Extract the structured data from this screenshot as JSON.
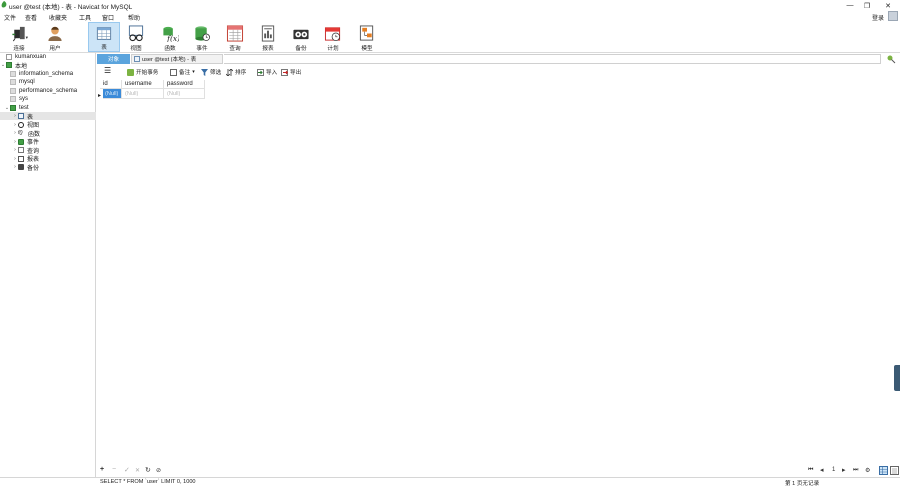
{
  "window": {
    "title": "user @test (本地) - 表 - Navicat for MySQL",
    "minimize": "—",
    "maximize": "❐",
    "close": "✕"
  },
  "menu": {
    "items": [
      "文件",
      "查看",
      "收藏夹",
      "工具",
      "窗口",
      "帮助"
    ],
    "login": "登录"
  },
  "ribbon": {
    "tools": [
      {
        "label": "连接",
        "icon": "connection-icon"
      },
      {
        "label": "用户",
        "icon": "user-icon"
      },
      {
        "label": "表",
        "icon": "table-icon"
      },
      {
        "label": "视图",
        "icon": "view-icon"
      },
      {
        "label": "函数",
        "icon": "function-icon"
      },
      {
        "label": "事件",
        "icon": "event-icon"
      },
      {
        "label": "查询",
        "icon": "query-icon"
      },
      {
        "label": "报表",
        "icon": "report-icon"
      },
      {
        "label": "备份",
        "icon": "backup-icon"
      },
      {
        "label": "计划",
        "icon": "schedule-icon"
      },
      {
        "label": "模型",
        "icon": "model-icon"
      }
    ],
    "active": "表"
  },
  "tree": {
    "root": "kumanxuan",
    "connection": "本地",
    "databases": [
      "information_schema",
      "mysql",
      "performance_schema",
      "sys"
    ],
    "open_db": "test",
    "children": [
      "表",
      "视图",
      "函数",
      "事件",
      "查询",
      "报表",
      "备份"
    ],
    "function_glyph": "f()"
  },
  "tabs": {
    "objects": "对象",
    "current": "user @test (本地) - 表"
  },
  "toolbar": {
    "menu_glyph": "☰",
    "begin_tx": "开始事务",
    "note": "备注",
    "note_caret": "▾",
    "filter": "筛选",
    "sort": "排序",
    "import": "导入",
    "export": "导出"
  },
  "grid": {
    "columns": [
      "id",
      "username",
      "password"
    ],
    "row_marker": "▸",
    "rows": [
      [
        "(Null)",
        "(Null)",
        "(Null)"
      ]
    ]
  },
  "bottom_nav": {
    "add": "+",
    "delete": "−",
    "apply": "✓",
    "cancel": "✕",
    "refresh": "↻",
    "stop": "⊘",
    "first": "⏮",
    "prev": "◂",
    "page": "1",
    "next": "▸",
    "last": "⏭",
    "settings": "⚙"
  },
  "status": {
    "sql": "SELECT * FROM `user` LIMIT 0, 1000",
    "page_info": "第 1 页无记录"
  },
  "colors": {
    "accent": "#3c8bd9",
    "tab_active": "#5ba4dd",
    "ribbon_active": "#cce4f7"
  }
}
